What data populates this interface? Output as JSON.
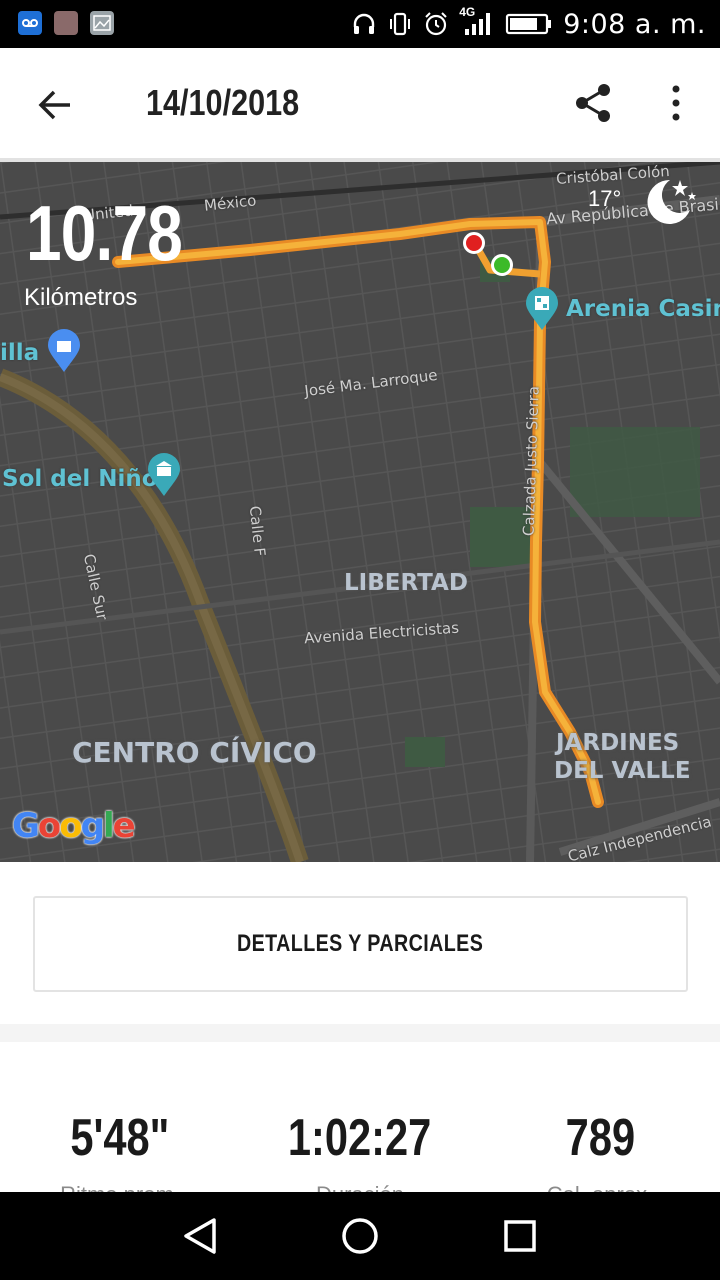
{
  "status_bar": {
    "time": "9:08 a. m.",
    "network": "4G",
    "icons": [
      "voicemail-icon",
      "contact-photo-icon",
      "gallery-icon",
      "headphones-icon",
      "vibrate-icon",
      "alarm-icon",
      "signal-icon",
      "battery-icon"
    ]
  },
  "app_bar": {
    "title": "14/10/2018",
    "back_icon": "arrow-left-icon",
    "share_icon": "share-icon",
    "more_icon": "more-vert-icon"
  },
  "map": {
    "distance": "10.78",
    "distance_unit": "Kilómetros",
    "temperature": "17°",
    "weather_icon": "moon-stars-icon",
    "labels": {
      "cristobal_colon": "Cristóbal Colón",
      "av_republica": "Av República de Brasil",
      "mexico": "México",
      "united": "United",
      "arenia": "Arenia Casino",
      "milla": "illa",
      "larroque": "José Ma. Larroque",
      "sol_nino": "Sol del Niño",
      "calle_f": "Calle F",
      "calle_sur": "Calle Sur",
      "justo_sierra": "Calzada Justo Sierra",
      "libertad": "LIBERTAD",
      "electricistas": "Avenida Electricistas",
      "centro_civico": "CENTRO CÍVICO",
      "jardines_1": "JARDINES",
      "jardines_2": "DEL VALLE",
      "independencia": "Calz Independencia"
    },
    "google": "Google",
    "route_color": "#f0a030",
    "start_marker_color": "#3cba28",
    "end_marker_color": "#e02020"
  },
  "details_button": {
    "label": "DETALLES Y PARCIALES"
  },
  "stats": [
    {
      "value": "5'48\"",
      "label": "Ritmo prom."
    },
    {
      "value": "1:02:27",
      "label": "Duración"
    },
    {
      "value": "789",
      "label": "Cal. aprox."
    }
  ],
  "nav_bar": {
    "back_icon": "triangle-back-icon",
    "home_icon": "circle-home-icon",
    "recents_icon": "square-recents-icon"
  }
}
